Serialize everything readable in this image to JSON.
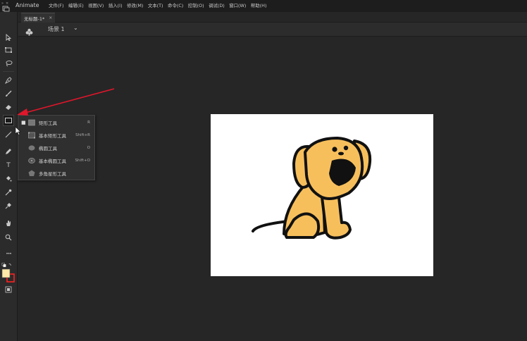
{
  "app": {
    "name": "Animate",
    "accent_color": "#e0162b"
  },
  "menubar": {
    "items": [
      "文件(F)",
      "编辑(E)",
      "视图(V)",
      "插入(I)",
      "修改(M)",
      "文本(T)",
      "命令(C)",
      "控制(O)",
      "调试(D)",
      "窗口(W)",
      "帮助(H)"
    ]
  },
  "document": {
    "tab_title": "无标题-1*",
    "tab_close": "×"
  },
  "scene": {
    "label": "场景 1",
    "chevron": "⌄"
  },
  "toolbar": {
    "tools": [
      "selection-tool-icon",
      "free-transform-icon",
      "lasso-icon",
      "pen-icon",
      "brush-icon",
      "eraser-icon",
      "rectangle-tool-icon",
      "line-tool-icon",
      "pencil-icon",
      "text-tool-icon",
      "paint-bucket-icon",
      "eyedropper-icon",
      "pin-icon",
      "hand-tool-icon",
      "zoom-tool-icon",
      "more-tools-icon"
    ],
    "text_tool_glyph": "T",
    "more_glyph": "•••",
    "stroke_color": "#ff2020",
    "fill_color": "#ffe9a8"
  },
  "flyout": {
    "items": [
      {
        "label": "矩形工具",
        "shortcut": "R",
        "selected": true
      },
      {
        "label": "基本矩形工具",
        "shortcut": "Shift+R",
        "selected": false
      },
      {
        "label": "椭圆工具",
        "shortcut": "O",
        "selected": false
      },
      {
        "label": "基本椭圆工具",
        "shortcut": "Shift+O",
        "selected": false
      },
      {
        "label": "多角星形工具",
        "shortcut": "",
        "selected": false
      }
    ]
  },
  "stage": {
    "background": "#ffffff",
    "illustration": "cartoon-dog",
    "dog_color": "#f7bf5c"
  }
}
